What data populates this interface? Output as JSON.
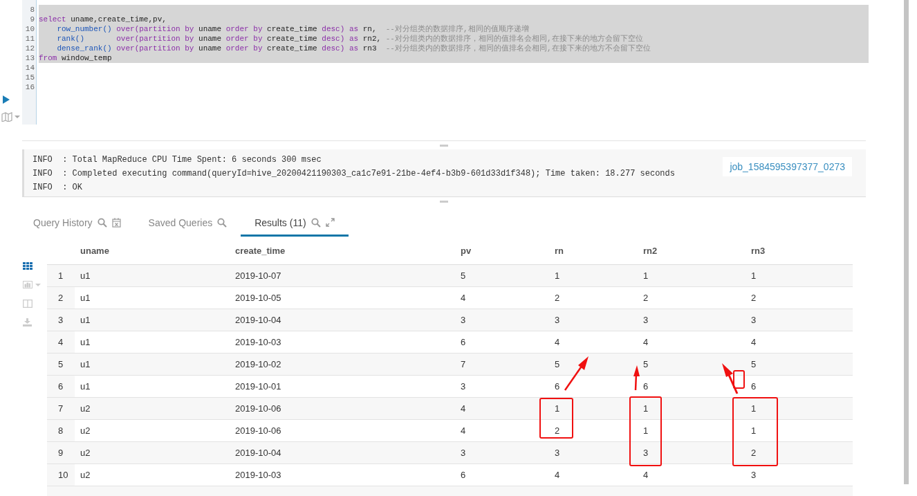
{
  "editor": {
    "lines": [
      {
        "number": "8",
        "selected": true
      },
      {
        "number": "9",
        "selected": true,
        "tokens": [
          {
            "kind": "keyword",
            "text": "select"
          },
          {
            "kind": "plain",
            "text": " uname,create_time,pv,"
          }
        ]
      },
      {
        "number": "10",
        "selected": true,
        "tokens": [
          {
            "kind": "function",
            "text": "    row_number()"
          },
          {
            "kind": "keyword",
            "text": " over(partition by"
          },
          {
            "kind": "plain",
            "text": " uname "
          },
          {
            "kind": "keyword",
            "text": "order by"
          },
          {
            "kind": "plain",
            "text": " create_time "
          },
          {
            "kind": "keyword",
            "text": "desc) as"
          },
          {
            "kind": "plain",
            "text": " rn,"
          },
          {
            "kind": "comment",
            "text": "  --对分组类的数据排序,相同的值顺序递增"
          }
        ]
      },
      {
        "number": "11",
        "selected": true,
        "tokens": [
          {
            "kind": "function",
            "text": "    rank()"
          },
          {
            "kind": "keyword",
            "text": "       over(partition by"
          },
          {
            "kind": "plain",
            "text": " uname "
          },
          {
            "kind": "keyword",
            "text": "order by"
          },
          {
            "kind": "plain",
            "text": " create_time "
          },
          {
            "kind": "keyword",
            "text": "desc) as"
          },
          {
            "kind": "plain",
            "text": " rn2,"
          },
          {
            "kind": "comment",
            "text": " --对分组类内的数据排序，相同的值排名会相同,在接下来的地方会留下空位"
          }
        ]
      },
      {
        "number": "12",
        "selected": true,
        "tokens": [
          {
            "kind": "function",
            "text": "    dense_rank()"
          },
          {
            "kind": "keyword",
            "text": " over(partition by"
          },
          {
            "kind": "plain",
            "text": " uname "
          },
          {
            "kind": "keyword",
            "text": "order by"
          },
          {
            "kind": "plain",
            "text": " create_time "
          },
          {
            "kind": "keyword",
            "text": "desc) as"
          },
          {
            "kind": "plain",
            "text": " rn3"
          },
          {
            "kind": "comment",
            "text": "  --对分组类内的数据排序，相同的值排名会相同,在接下来的地方不会留下空位"
          }
        ]
      },
      {
        "number": "13",
        "selected": true,
        "tokens": [
          {
            "kind": "keyword",
            "text": "from"
          },
          {
            "kind": "plain",
            "text": " window_temp"
          }
        ]
      },
      {
        "number": "14",
        "selected": false
      },
      {
        "number": "15",
        "selected": false
      },
      {
        "number": "16",
        "selected": false
      }
    ]
  },
  "log": {
    "lines": [
      "INFO  : Total MapReduce CPU Time Spent: 6 seconds 300 msec",
      "INFO  : Completed executing command(queryId=hive_20200421190303_ca1c7e91-21be-4ef4-b3b9-601d33d1f348); Time taken: 18.277 seconds",
      "INFO  : OK"
    ],
    "job_link": "job_1584595397377_0273"
  },
  "tabs": [
    {
      "label": "Query History",
      "selected": false
    },
    {
      "label": "Saved Queries",
      "selected": false
    },
    {
      "label": "Results (11)",
      "selected": true
    }
  ],
  "view_buttons": [
    {
      "selected": true
    },
    {
      "selected": false
    },
    {
      "selected": false
    },
    {
      "selected": false
    }
  ],
  "table": {
    "columns": [
      null,
      "uname",
      "create_time",
      "pv",
      "rn",
      "rn2",
      "rn3"
    ],
    "rows": [
      [
        "1",
        "u1",
        "2019-10-07",
        "5",
        "1",
        "1",
        "1"
      ],
      [
        "2",
        "u1",
        "2019-10-05",
        "4",
        "2",
        "2",
        "2"
      ],
      [
        "3",
        "u1",
        "2019-10-04",
        "3",
        "3",
        "3",
        "3"
      ],
      [
        "4",
        "u1",
        "2019-10-03",
        "6",
        "4",
        "4",
        "4"
      ],
      [
        "5",
        "u1",
        "2019-10-02",
        "7",
        "5",
        "5",
        "5"
      ],
      [
        "6",
        "u1",
        "2019-10-01",
        "3",
        "6",
        "6",
        "6"
      ],
      [
        "7",
        "u2",
        "2019-10-06",
        "4",
        "1",
        "1",
        "1"
      ],
      [
        "8",
        "u2",
        "2019-10-06",
        "4",
        "2",
        "1",
        "1"
      ],
      [
        "9",
        "u2",
        "2019-10-04",
        "3",
        "3",
        "3",
        "2"
      ],
      [
        "10",
        "u2",
        "2019-10-03",
        "6",
        "4",
        "4",
        "3"
      ]
    ]
  }
}
